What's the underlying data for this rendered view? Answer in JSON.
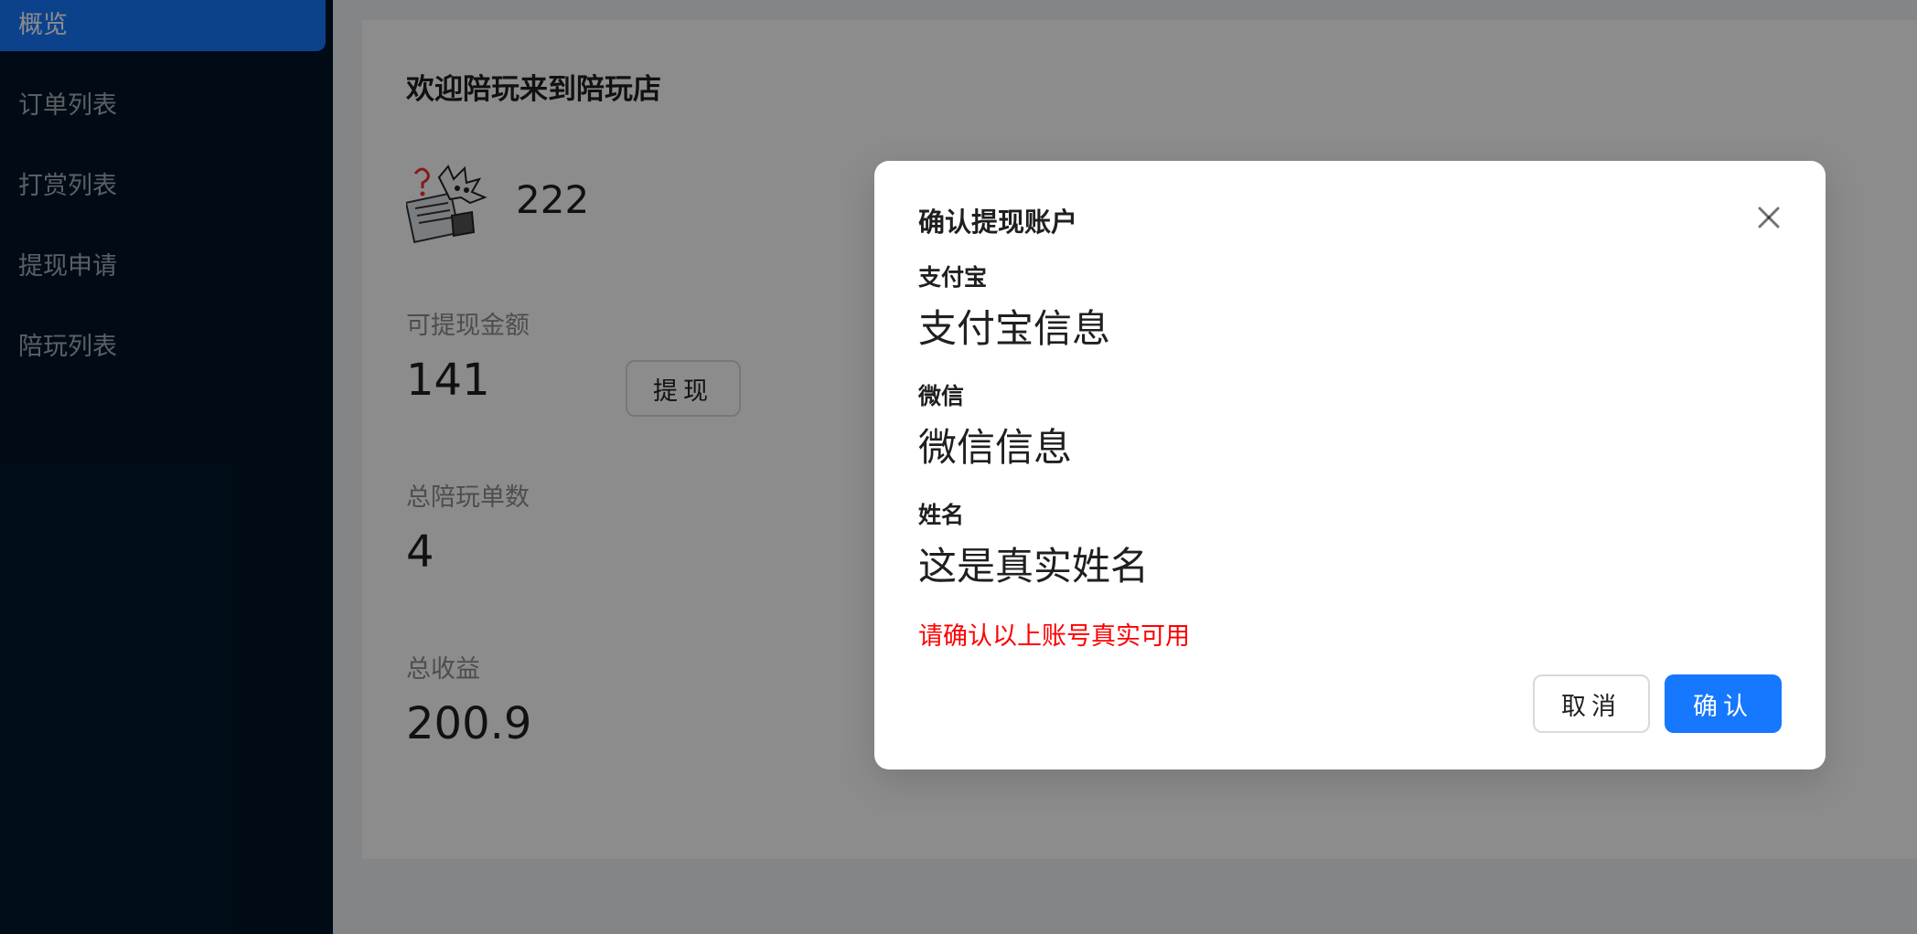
{
  "sidebar": {
    "items": [
      {
        "label": "概览",
        "active": true
      },
      {
        "label": "订单列表",
        "active": false
      },
      {
        "label": "打赏列表",
        "active": false
      },
      {
        "label": "提现申请",
        "active": false
      },
      {
        "label": "陪玩列表",
        "active": false
      }
    ]
  },
  "dashboard": {
    "welcome": "欢迎陪玩来到陪玩店",
    "username": "222",
    "withdrawable_label": "可提现金额",
    "withdrawable_value": "141",
    "withdraw_button": "提现",
    "total_orders_label": "总陪玩单数",
    "total_orders_value": "4",
    "total_income_label": "总收益",
    "total_income_value": "200.9"
  },
  "modal": {
    "title": "确认提现账户",
    "alipay_label": "支付宝",
    "alipay_value": "支付宝信息",
    "wechat_label": "微信",
    "wechat_value": "微信信息",
    "name_label": "姓名",
    "name_value": "这是真实姓名",
    "warning": "请确认以上账号真实可用",
    "cancel_label": "取消",
    "ok_label": "确认"
  },
  "colors": {
    "sidebar_bg": "#001529",
    "primary": "#1677ff",
    "warning_text": "#ff0000"
  },
  "icons": {
    "close": "close-icon",
    "avatar": "cartoon-avatar"
  }
}
